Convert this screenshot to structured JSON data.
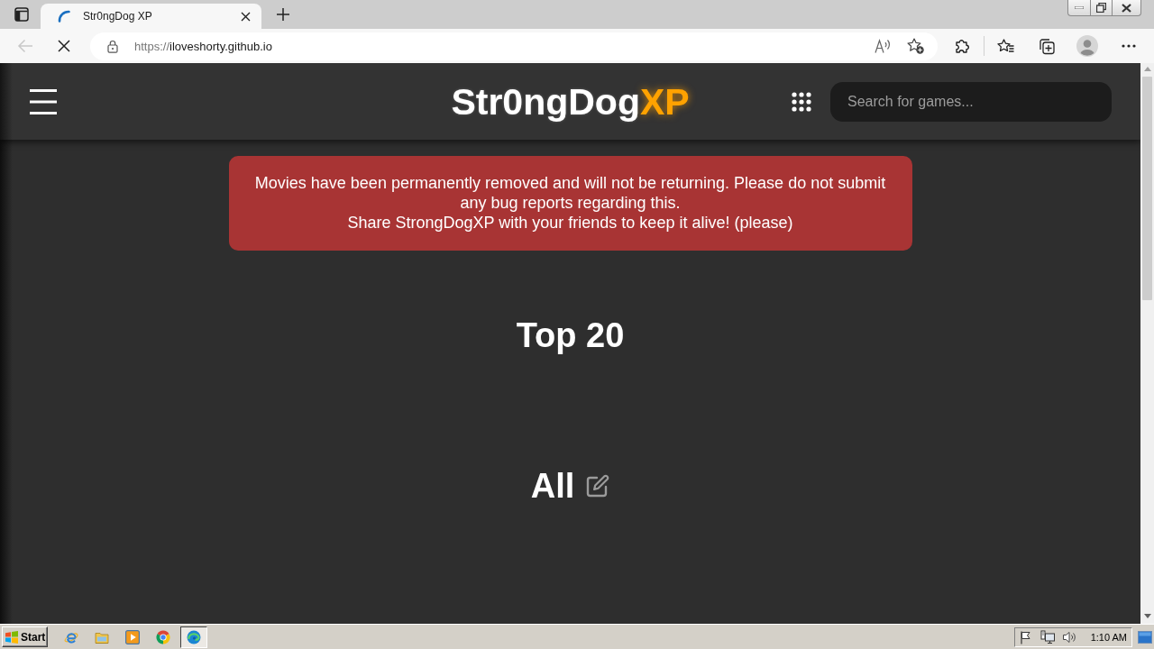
{
  "browser": {
    "tabs": [
      {
        "title": "Str0ngDog XP",
        "selected": true,
        "loading": true
      }
    ],
    "toolbar": {
      "back_disabled": true,
      "address": {
        "scheme": "https://",
        "host": "iloveshorty.github.io"
      }
    }
  },
  "page": {
    "header": {
      "logo": {
        "text": "Str0ngDog",
        "accent": "XP"
      },
      "search": {
        "placeholder": "Search for games..."
      }
    },
    "notice": {
      "lines": [
        "Movies have been permanently removed and will not be returning. Please do not submit any bug reports regarding this.",
        "Share StrongDogXP with your friends to keep it alive! (please)"
      ]
    },
    "sections": [
      {
        "title": "Top 20",
        "editable": false
      },
      {
        "title": "All",
        "editable": true
      }
    ]
  },
  "taskbar": {
    "start": "Start",
    "apps": [
      {
        "kind": "ie",
        "selected": false
      },
      {
        "kind": "explorer",
        "selected": false
      },
      {
        "kind": "media",
        "selected": false
      },
      {
        "kind": "chrome",
        "selected": false
      },
      {
        "kind": "edge",
        "selected": true
      }
    ],
    "clock": "1:10 AM"
  }
}
